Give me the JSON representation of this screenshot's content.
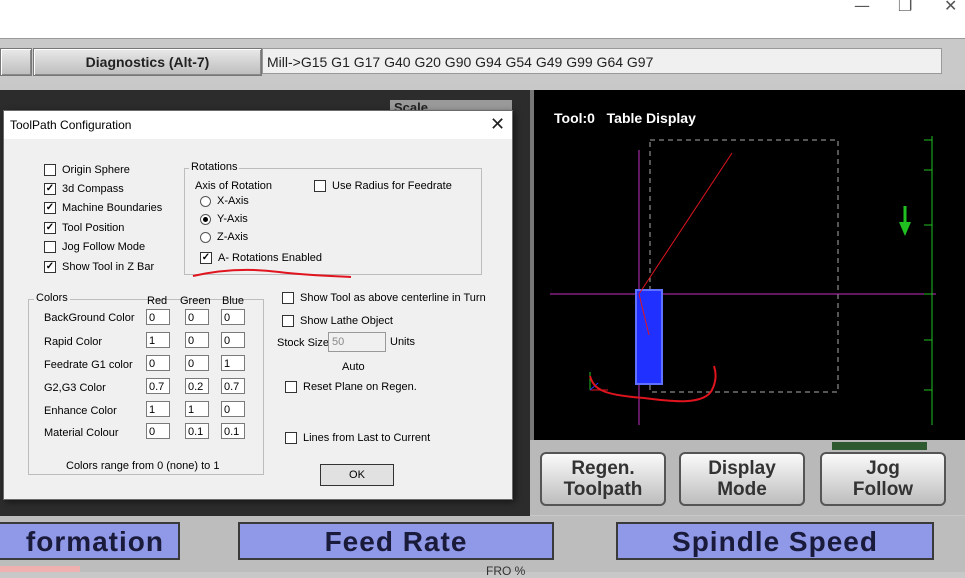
{
  "window_controls": {
    "minimize": "—",
    "restore": "❐",
    "close": "✕"
  },
  "toolbar": {
    "diagnostics_tab": "Diagnostics (Alt-7)",
    "gcode_modal": "Mill->G15  G1 G17 G40 G20 G90 G94 G54 G49 G99 G64 G97"
  },
  "background_panel": {
    "scale_label": "Scale"
  },
  "display": {
    "tool_label": "Tool:0",
    "mode_label": "Table Display"
  },
  "buttons": {
    "regen_line1": "Regen.",
    "regen_line2": "Toolpath",
    "display_line1": "Display",
    "display_line2": "Mode",
    "jog_line1": "Jog",
    "jog_line2": "Follow"
  },
  "banners": {
    "information": "formation",
    "feed_rate": "Feed Rate",
    "spindle_speed": "Spindle Speed",
    "fro": "FRO %"
  },
  "dialog": {
    "title": "ToolPath Configuration",
    "close_glyph": "✕",
    "checkboxes": [
      {
        "label": "Origin Sphere",
        "checked": false
      },
      {
        "label": "3d Compass",
        "checked": true
      },
      {
        "label": "Machine Boundaries",
        "checked": true
      },
      {
        "label": "Tool Position",
        "checked": true
      },
      {
        "label": "Jog Follow Mode",
        "checked": false
      },
      {
        "label": "Show Tool in Z Bar",
        "checked": true
      }
    ],
    "rotations": {
      "group_label": "Rotations",
      "axis_label": "Axis of Rotation",
      "use_radius": {
        "label": "Use Radius for Feedrate",
        "checked": false
      },
      "axes": [
        {
          "label": "X-Axis",
          "selected": false
        },
        {
          "label": "Y-Axis",
          "selected": true
        },
        {
          "label": "Z-Axis",
          "selected": false
        }
      ],
      "enabled": {
        "label": "A- Rotations Enabled",
        "checked": true
      }
    },
    "colors": {
      "group_label": "Colors",
      "headers": [
        "Red",
        "Green",
        "Blue"
      ],
      "rows": [
        {
          "label": "BackGround Color",
          "values": [
            "0",
            "0",
            "0"
          ]
        },
        {
          "label": "Rapid Color",
          "values": [
            "1",
            "0",
            "0"
          ]
        },
        {
          "label": "Feedrate G1 color",
          "values": [
            "0",
            "0",
            "1"
          ]
        },
        {
          "label": "G2,G3 Color",
          "values": [
            "0.7",
            "0.2",
            "0.7"
          ]
        },
        {
          "label": "Enhance Color",
          "values": [
            "1",
            "1",
            "0"
          ]
        },
        {
          "label": "Material Colour",
          "values": [
            "0",
            "0.1",
            "0.1"
          ]
        }
      ],
      "range_note": "Colors range from 0 (none) to 1"
    },
    "options": {
      "show_tool_above": {
        "label": "Show Tool as above centerline in Turn",
        "checked": false
      },
      "show_lathe": {
        "label": "Show Lathe Object",
        "checked": false
      },
      "stock_size_label": "Stock Size",
      "stock_size_value": "50",
      "units_label": "Units",
      "auto_label": "Auto",
      "reset_plane": {
        "label": "Reset Plane on Regen.",
        "checked": false
      },
      "lines_from_last": {
        "label": "Lines from Last to Current",
        "checked": false
      }
    },
    "ok_label": "OK"
  },
  "colors": {
    "annotation_red": "#e0141e",
    "toolpath_blue": "#2030ff",
    "axis_magenta": "#c030c0",
    "axis_green": "#20c020",
    "banner_blue": "#8f99e8"
  }
}
